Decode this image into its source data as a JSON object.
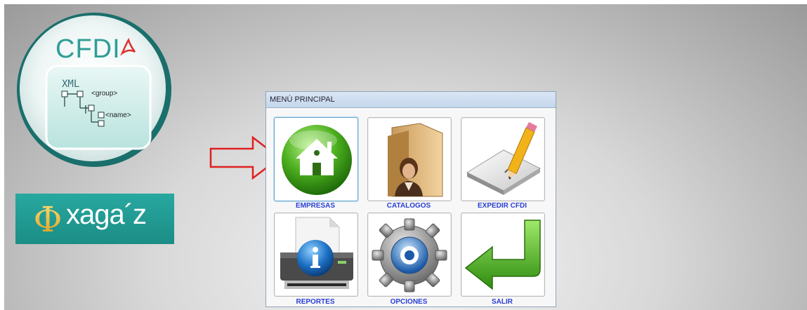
{
  "logos": {
    "cfdi": {
      "title": "CFDI",
      "xml": "XML",
      "tree": [
        "<group>",
        "<name>"
      ]
    },
    "oxagaz": {
      "symbol": "Φ",
      "text": "xaga´z"
    }
  },
  "menu": {
    "title": "MENÚ PRINCIPAL",
    "items": [
      {
        "label": "EMPRESAS",
        "icon": "house-icon"
      },
      {
        "label": "CATALOGOS",
        "icon": "folder-person-icon"
      },
      {
        "label": "EXPEDIR CFDI",
        "icon": "pencil-paper-icon"
      },
      {
        "label": "REPORTES",
        "icon": "printer-info-icon"
      },
      {
        "label": "OPCIONES",
        "icon": "gear-icon"
      },
      {
        "label": "SALIR",
        "icon": "return-arrow-icon"
      }
    ]
  },
  "colors": {
    "label": "#2a3fd6",
    "teal": "#2f9d96",
    "arrow": "#e02020"
  }
}
